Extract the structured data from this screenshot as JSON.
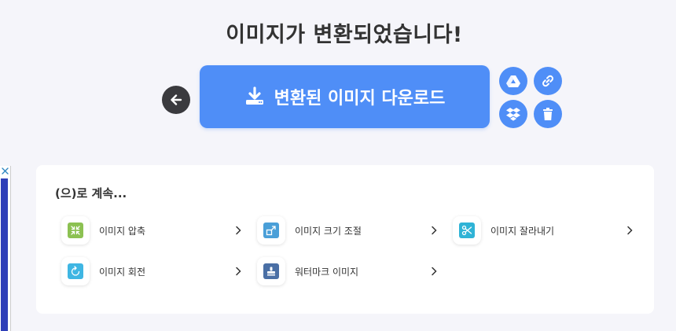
{
  "header": {
    "title": "이미지가 변환되었습니다!"
  },
  "actions": {
    "download_label": "변환된 이미지 다운로드",
    "back_icon": "arrow-left-icon",
    "download_icon": "download-icon",
    "save_options": [
      "google-drive-icon",
      "link-icon",
      "dropbox-icon",
      "trash-icon"
    ]
  },
  "continue": {
    "heading": "(으)로 계속...",
    "items": [
      {
        "label": "이미지 압축",
        "icon": "compress-icon",
        "color": "#8cc152"
      },
      {
        "label": "이미지 크기 조절",
        "icon": "resize-icon",
        "color": "#4a9fd8"
      },
      {
        "label": "이미지 잘라내기",
        "icon": "scissors-icon",
        "color": "#2fb3d6"
      },
      {
        "label": "이미지 회전",
        "icon": "rotate-icon",
        "color": "#3fb6e3"
      },
      {
        "label": "워터마크 이미지",
        "icon": "stamp-icon",
        "color": "#4a6fa5"
      }
    ]
  },
  "colors": {
    "accent": "#4f8ef7",
    "background": "#f5f5fa",
    "back_button": "#3a3a3e"
  }
}
